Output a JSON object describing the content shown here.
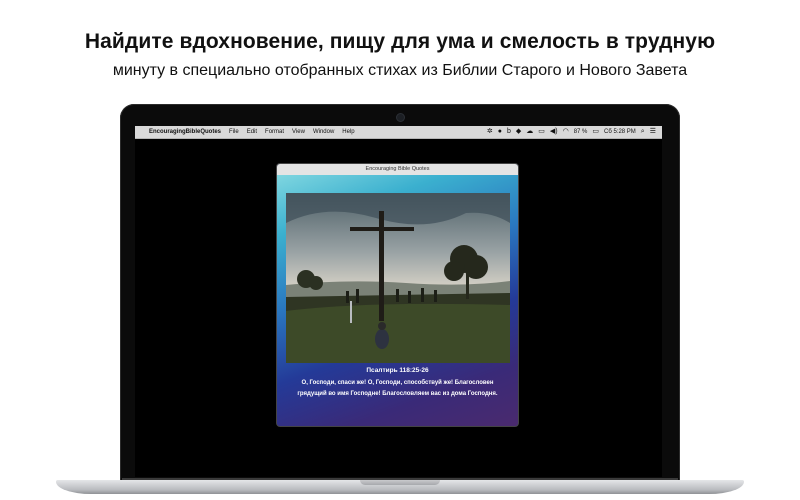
{
  "promo": {
    "headline": "Найдите вдохновение, пищу для ума и смелость в трудную",
    "subheadline": "минуту в специально отобранных стихах из Библии Старого и Нового Завета"
  },
  "menubar": {
    "app_name": "EncouragingBibleQuotes",
    "items": [
      "File",
      "Edit",
      "Format",
      "View",
      "Window",
      "Help"
    ],
    "battery": "87 %",
    "clock": "Сб 5:28 PM"
  },
  "window": {
    "title": "Encouraging Bible Quotes",
    "reference": "Псалтирь 118:25-26",
    "verse": "О, Господи, спаси же! О, Господи, способствуй же! Благословен грядущий во имя Господне! Благословляем вас из дома Господня.",
    "gradient_colors": [
      "#7fd6e0",
      "#2a78c0",
      "#243a98",
      "#4a2a6e"
    ]
  },
  "icons": {
    "apple": "apple-logo-icon",
    "tray": [
      "brightness-icon",
      "shield-icon",
      "b-icon",
      "dropbox-icon",
      "cloud-icon",
      "airplay-icon",
      "volume-icon",
      "wifi-icon",
      "battery-icon",
      "search-icon",
      "list-icon"
    ]
  }
}
